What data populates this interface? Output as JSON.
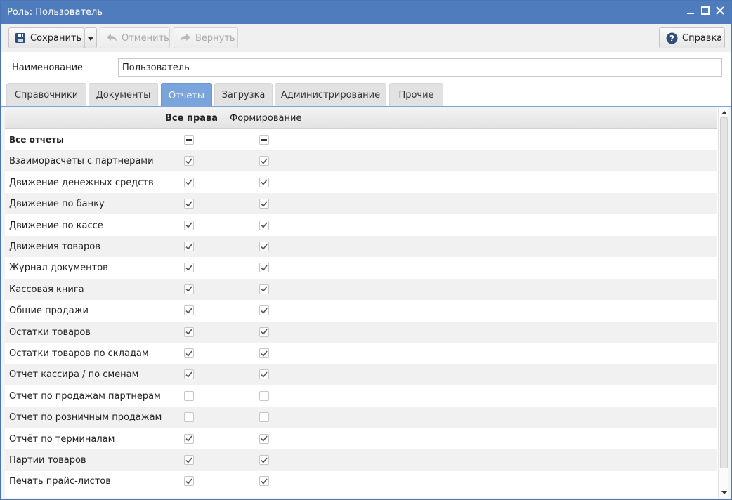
{
  "window": {
    "title": "Роль: Пользователь"
  },
  "toolbar": {
    "save_label": "Сохранить",
    "undo_label": "Отменить",
    "redo_label": "Вернуть",
    "help_label": "Справка"
  },
  "name_field": {
    "label": "Наименование",
    "value": "Пользователь"
  },
  "tabs": [
    {
      "label": "Справочники",
      "active": false
    },
    {
      "label": "Документы",
      "active": false
    },
    {
      "label": "Отчеты",
      "active": true
    },
    {
      "label": "Загрузка",
      "active": false
    },
    {
      "label": "Администрирование",
      "active": false
    },
    {
      "label": "Прочие",
      "active": false
    }
  ],
  "grid": {
    "columns": {
      "all_rights": "Все права",
      "generate": "Формирование"
    },
    "rows": [
      {
        "name": "Все отчеты",
        "all": "partial",
        "gen": "partial"
      },
      {
        "name": "Взаиморасчеты с партнерами",
        "all": "checked",
        "gen": "checked"
      },
      {
        "name": "Движение денежных средств",
        "all": "checked",
        "gen": "checked"
      },
      {
        "name": "Движение по банку",
        "all": "checked",
        "gen": "checked"
      },
      {
        "name": "Движение по кассе",
        "all": "checked",
        "gen": "checked"
      },
      {
        "name": "Движения товаров",
        "all": "checked",
        "gen": "checked"
      },
      {
        "name": "Журнал документов",
        "all": "checked",
        "gen": "checked"
      },
      {
        "name": "Кассовая книга",
        "all": "checked",
        "gen": "checked"
      },
      {
        "name": "Общие продажи",
        "all": "checked",
        "gen": "checked"
      },
      {
        "name": "Остатки товаров",
        "all": "checked",
        "gen": "checked"
      },
      {
        "name": "Остатки товаров по складам",
        "all": "checked",
        "gen": "checked"
      },
      {
        "name": "Отчет кассира / по сменам",
        "all": "checked",
        "gen": "checked"
      },
      {
        "name": "Отчет по продажам партнерам",
        "all": "unchecked",
        "gen": "unchecked"
      },
      {
        "name": "Отчет по розничным продажам",
        "all": "unchecked",
        "gen": "unchecked"
      },
      {
        "name": "Отчёт по терминалам",
        "all": "checked",
        "gen": "checked"
      },
      {
        "name": "Партии товаров",
        "all": "checked",
        "gen": "checked"
      },
      {
        "name": "Печать прайс-листов",
        "all": "checked",
        "gen": "checked"
      }
    ]
  },
  "colors": {
    "titlebar": "#4f7cbd",
    "active_tab": "#7aa5dc"
  }
}
